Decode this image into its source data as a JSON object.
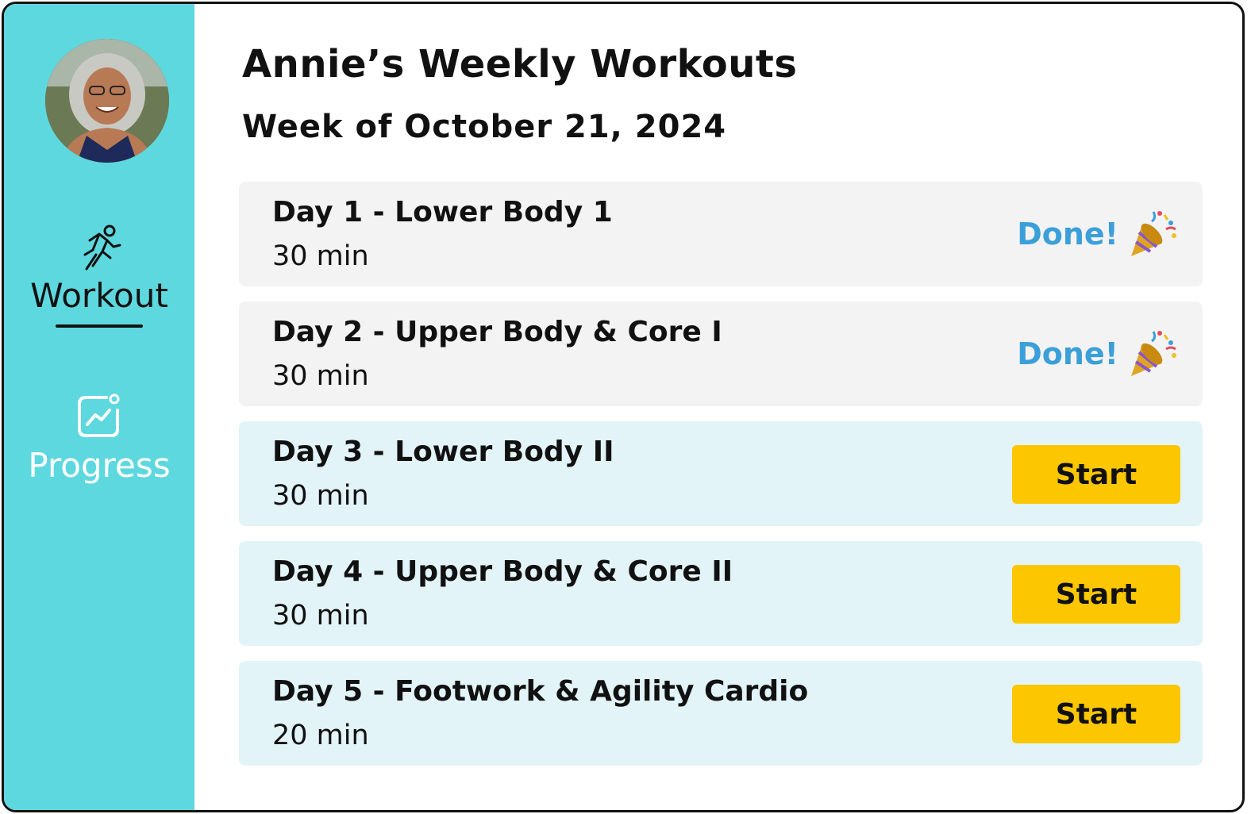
{
  "sidebar": {
    "avatar_alt": "Annie profile photo",
    "nav": [
      {
        "label": "Workout",
        "icon": "running-person-icon",
        "active": true
      },
      {
        "label": "Progress",
        "icon": "chart-trend-icon",
        "active": false
      }
    ]
  },
  "header": {
    "title": "Annie’s Weekly Workouts",
    "subtitle": "Week of October 21, 2024"
  },
  "workouts": [
    {
      "title": "Day 1 - Lower Body 1",
      "duration": "30 min",
      "status": "done",
      "status_label": "Done!",
      "status_icon": "party-popper-icon"
    },
    {
      "title": "Day 2 - Upper Body & Core I",
      "duration": "30 min",
      "status": "done",
      "status_label": "Done!",
      "status_icon": "party-popper-icon"
    },
    {
      "title": "Day 3 - Lower Body II",
      "duration": "30 min",
      "status": "todo",
      "action_label": "Start"
    },
    {
      "title": "Day 4 - Upper Body & Core II",
      "duration": "30 min",
      "status": "todo",
      "action_label": "Start"
    },
    {
      "title": "Day 5 - Footwork & Agility Cardio",
      "duration": "20 min",
      "status": "todo",
      "action_label": "Start"
    }
  ],
  "colors": {
    "sidebar_bg": "#5ed8df",
    "done_card_bg": "#f3f3f3",
    "todo_card_bg": "#e2f4f8",
    "done_text": "#3b9fd9",
    "start_button": "#fcc600"
  }
}
